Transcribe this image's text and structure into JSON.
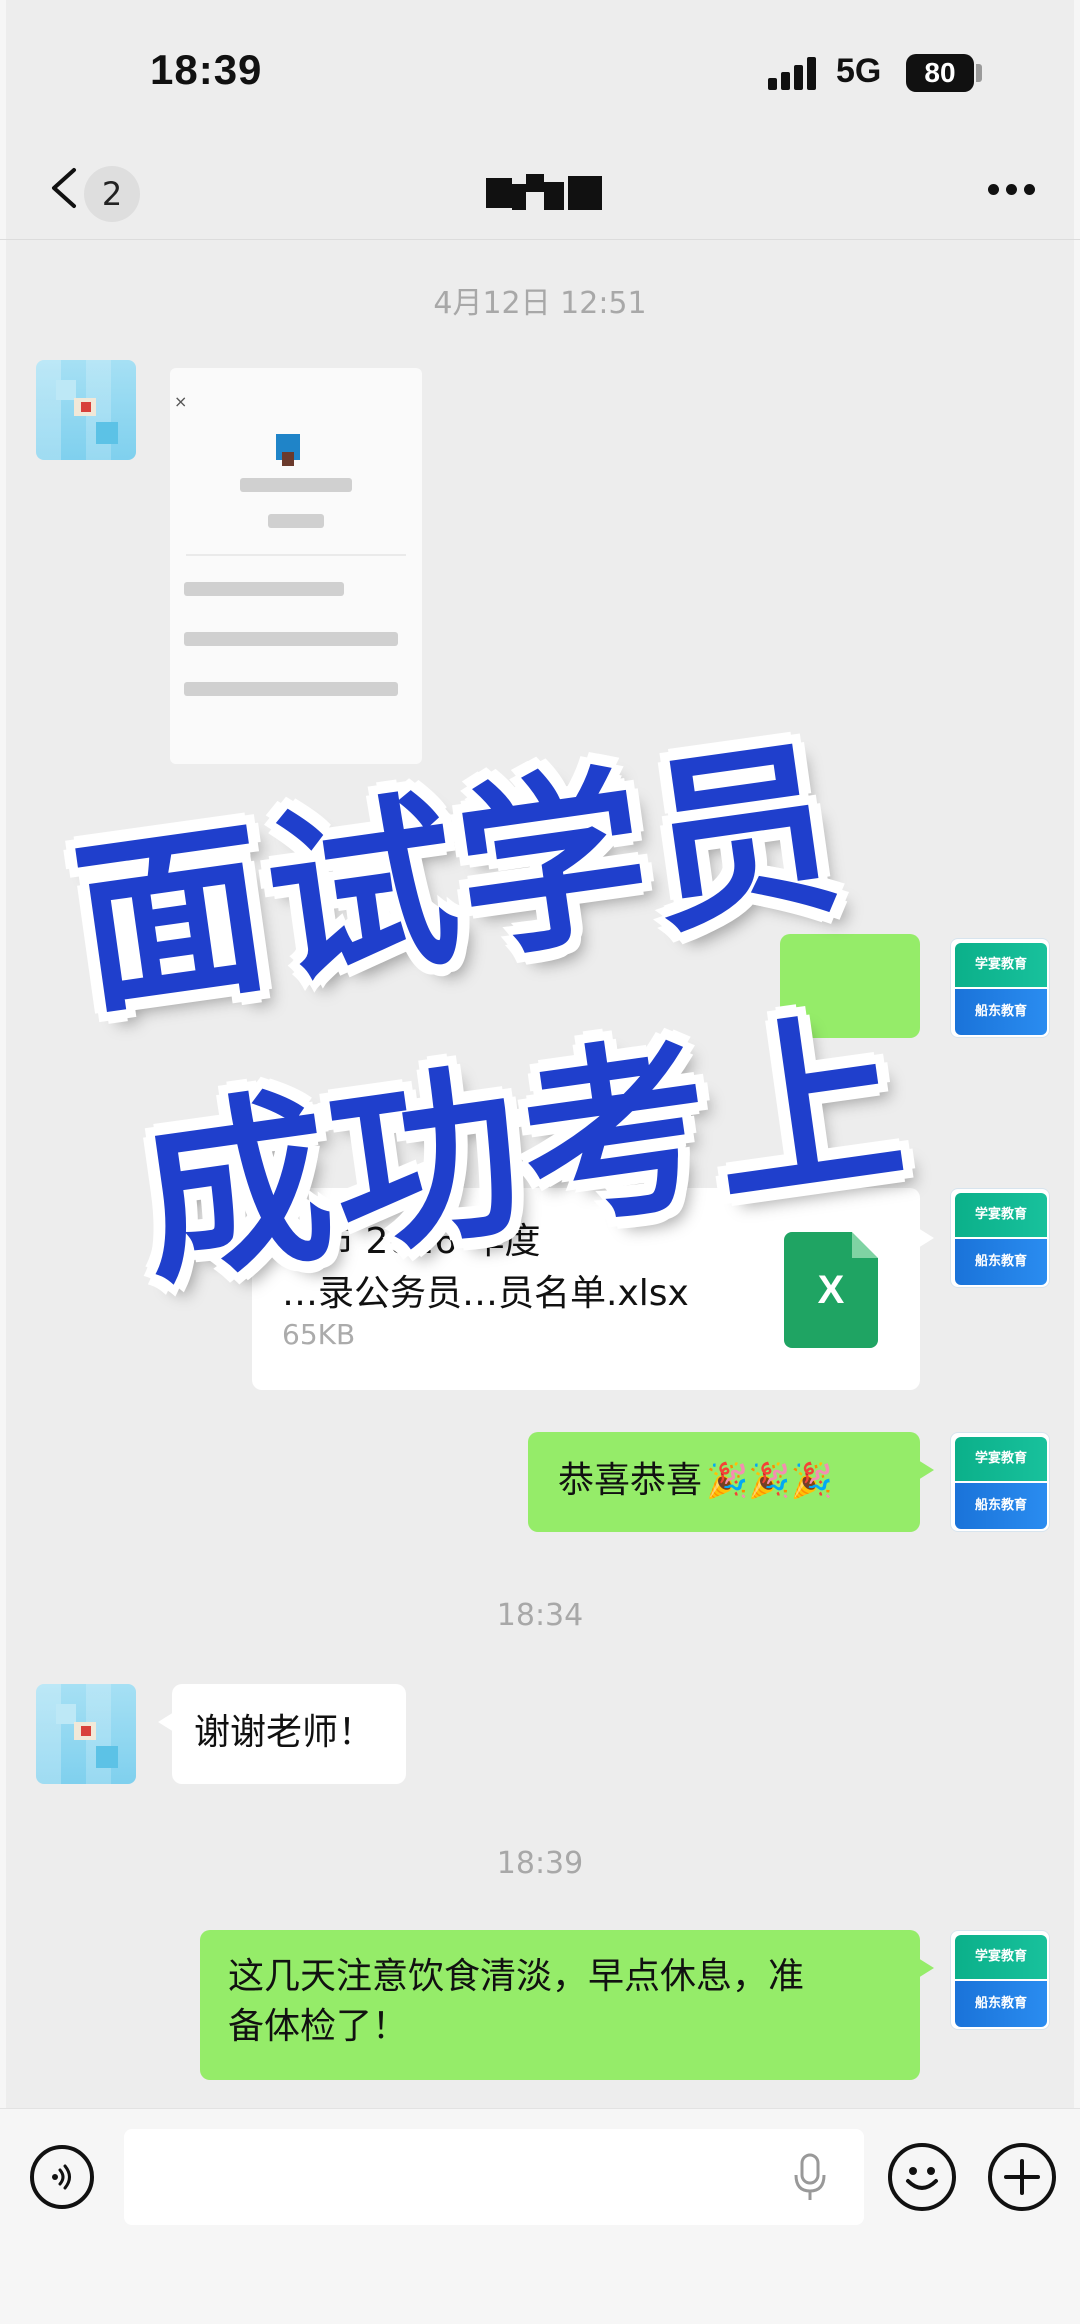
{
  "status_bar": {
    "time": "18:39",
    "network": "5G",
    "battery": "80"
  },
  "nav": {
    "unread_count": "2"
  },
  "messages": {
    "ts1": "4月12日 12:51",
    "file": {
      "name_line1": "…市 2026 年度",
      "name_line2": "…录公务员…员名单.xlsx",
      "size": "65KB",
      "icon_label": "X"
    },
    "congrats": "恭喜恭喜",
    "ts2": "18:34",
    "thanks": "谢谢老师！",
    "ts3": "18:39",
    "advice_line1": "这几天注意饮食清淡，早点休息，准",
    "advice_line2": "备体检了！"
  },
  "self_avatar": {
    "top_text": "学宴教育",
    "bottom_text": "船东教育"
  },
  "overlay": {
    "line1": "面试学员",
    "line2": "成功考上"
  },
  "colors": {
    "self_bubble": "#95ec69",
    "stamp_text": "#1f3fcc",
    "background": "#ededed"
  },
  "icons": [
    "back-chevron-icon",
    "more-icon",
    "voice-icon",
    "mic-icon",
    "emoji-icon",
    "plus-icon",
    "excel-file-icon",
    "party-popper-icon"
  ]
}
